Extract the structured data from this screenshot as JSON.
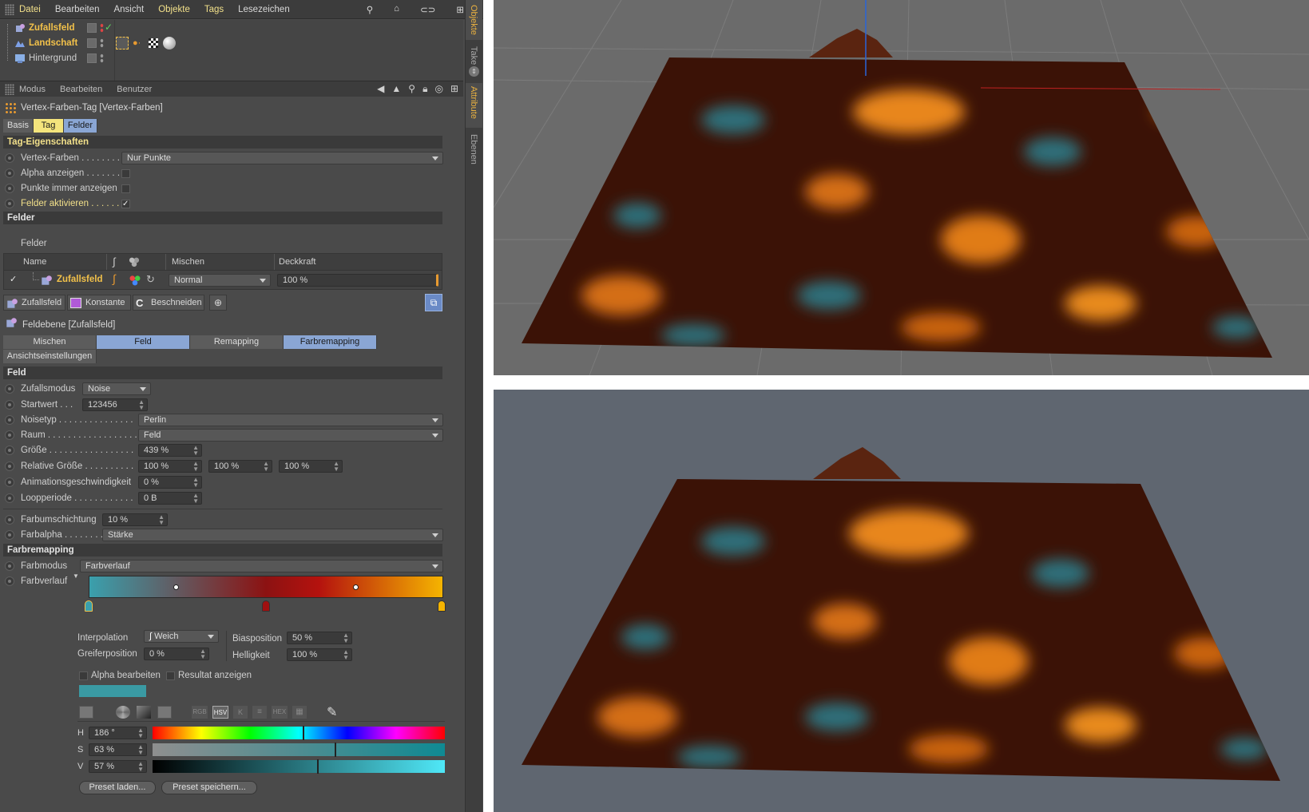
{
  "menu": {
    "items": [
      "Datei",
      "Bearbeiten",
      "Ansicht",
      "Objekte",
      "Tags",
      "Lesezeichen"
    ]
  },
  "objects": [
    {
      "name": "Zufallsfeld",
      "color": "#f2c14a"
    },
    {
      "name": "Landschaft",
      "color": "#f2c14a"
    },
    {
      "name": "Hintergrund",
      "color": "#cfcfcf"
    }
  ],
  "side_tabs": {
    "objekte": "Objekte",
    "take": "Take",
    "attribute": "Attribute",
    "ebenen": "Ebenen"
  },
  "attr_menu": [
    "Modus",
    "Bearbeiten",
    "Benutzer"
  ],
  "tag_title": "Vertex-Farben-Tag [Vertex-Farben]",
  "tabs": {
    "basis": "Basis",
    "tag": "Tag",
    "felder": "Felder"
  },
  "tag_props": {
    "section": "Tag-Eigenschaften",
    "vertex_label": "Vertex-Farben . . . . . . . .",
    "vertex_value": "Nur Punkte",
    "alpha_label": "Alpha anzeigen . . . . . . .",
    "punkte_label": "Punkte immer anzeigen",
    "felder_label": "Felder aktivieren . . . . . .",
    "felder_check": "✓"
  },
  "felder": {
    "section": "Felder",
    "sub": "Felder",
    "col_name": "Name",
    "col_mischen": "Mischen",
    "col_deckkraft": "Deckkraft",
    "row_check": "✓",
    "row_name": "Zufallsfeld",
    "row_mischen": "Normal",
    "row_deckkraft": "100 %"
  },
  "field_buttons": {
    "zufallsfeld": "Zufallsfeld",
    "konstante": "Konstante",
    "beschneiden": "Beschneiden"
  },
  "layer_title": "Feldebene [Zufallsfeld]",
  "layer_tabs": {
    "mischen": "Mischen",
    "feld": "Feld",
    "remapping": "Remapping",
    "farbremapping": "Farbremapping",
    "ansicht": "Ansichtseinstellungen"
  },
  "feld": {
    "section": "Feld",
    "zufallsmodus_label": "Zufallsmodus",
    "zufallsmodus_value": "Noise",
    "startwert_label": "Startwert . . .",
    "startwert_value": "123456",
    "noisetyp_label": "Noisetyp . . . . . . . . . . . . . . .",
    "noisetyp_value": "Perlin",
    "raum_label": "Raum . . . . . . . . . . . . . . . . . .",
    "raum_value": "Feld",
    "groesse_label": "Größe . . . . . . . . . . . . . . . . .",
    "groesse_value": "439 %",
    "rel_label": "Relative Größe . . . . . . . . . .",
    "rel_values": [
      "100 %",
      "100 %",
      "100 %"
    ],
    "anim_label": "Animationsgeschwindigkeit",
    "anim_value": "0 %",
    "loop_label": "Loopperiode . . . . . . . . . . . .",
    "loop_value": "0 B",
    "farbum_label": "Farbumschichtung",
    "farbum_value": "10 %",
    "farbalpha_label": "Farbalpha . . . . . . . .",
    "farbalpha_value": "Stärke"
  },
  "farbremapping": {
    "section": "Farbremapping",
    "farbmodus_label": "Farbmodus",
    "farbmodus_value": "Farbverlauf",
    "farbverlauf_label": "Farbverlauf",
    "gradient_colors": [
      "#3aa0ad",
      "#8c1212",
      "#b4120e",
      "#f5b400"
    ],
    "interpolation_label": "Interpolation",
    "interpolation_value": "Weich",
    "greifer_label": "Greiferposition",
    "greifer_value": "0 %",
    "bias_label": "Biasposition",
    "bias_value": "50 %",
    "hell_label": "Helligkeit",
    "hell_value": "100 %",
    "alpha_label": "Alpha bearbeiten",
    "resultat_label": "Resultat anzeigen",
    "swatch_color": "#3a9aa3",
    "mode_icons": [
      "RGB",
      "HSV",
      "K",
      "≡",
      "HEX",
      "▦"
    ],
    "h_label": "H",
    "h_value": "186 °",
    "h_level": 0.52,
    "s_label": "S",
    "s_value": "63 %",
    "s_level": 0.63,
    "v_label": "V",
    "v_value": "57 %",
    "v_level": 0.57,
    "preset_laden": "Preset laden...",
    "preset_speichern": "Preset speichern..."
  },
  "colors": {
    "orange": "#e88a1a",
    "teal": "#2e7f8a",
    "dark": "#3a1206"
  }
}
